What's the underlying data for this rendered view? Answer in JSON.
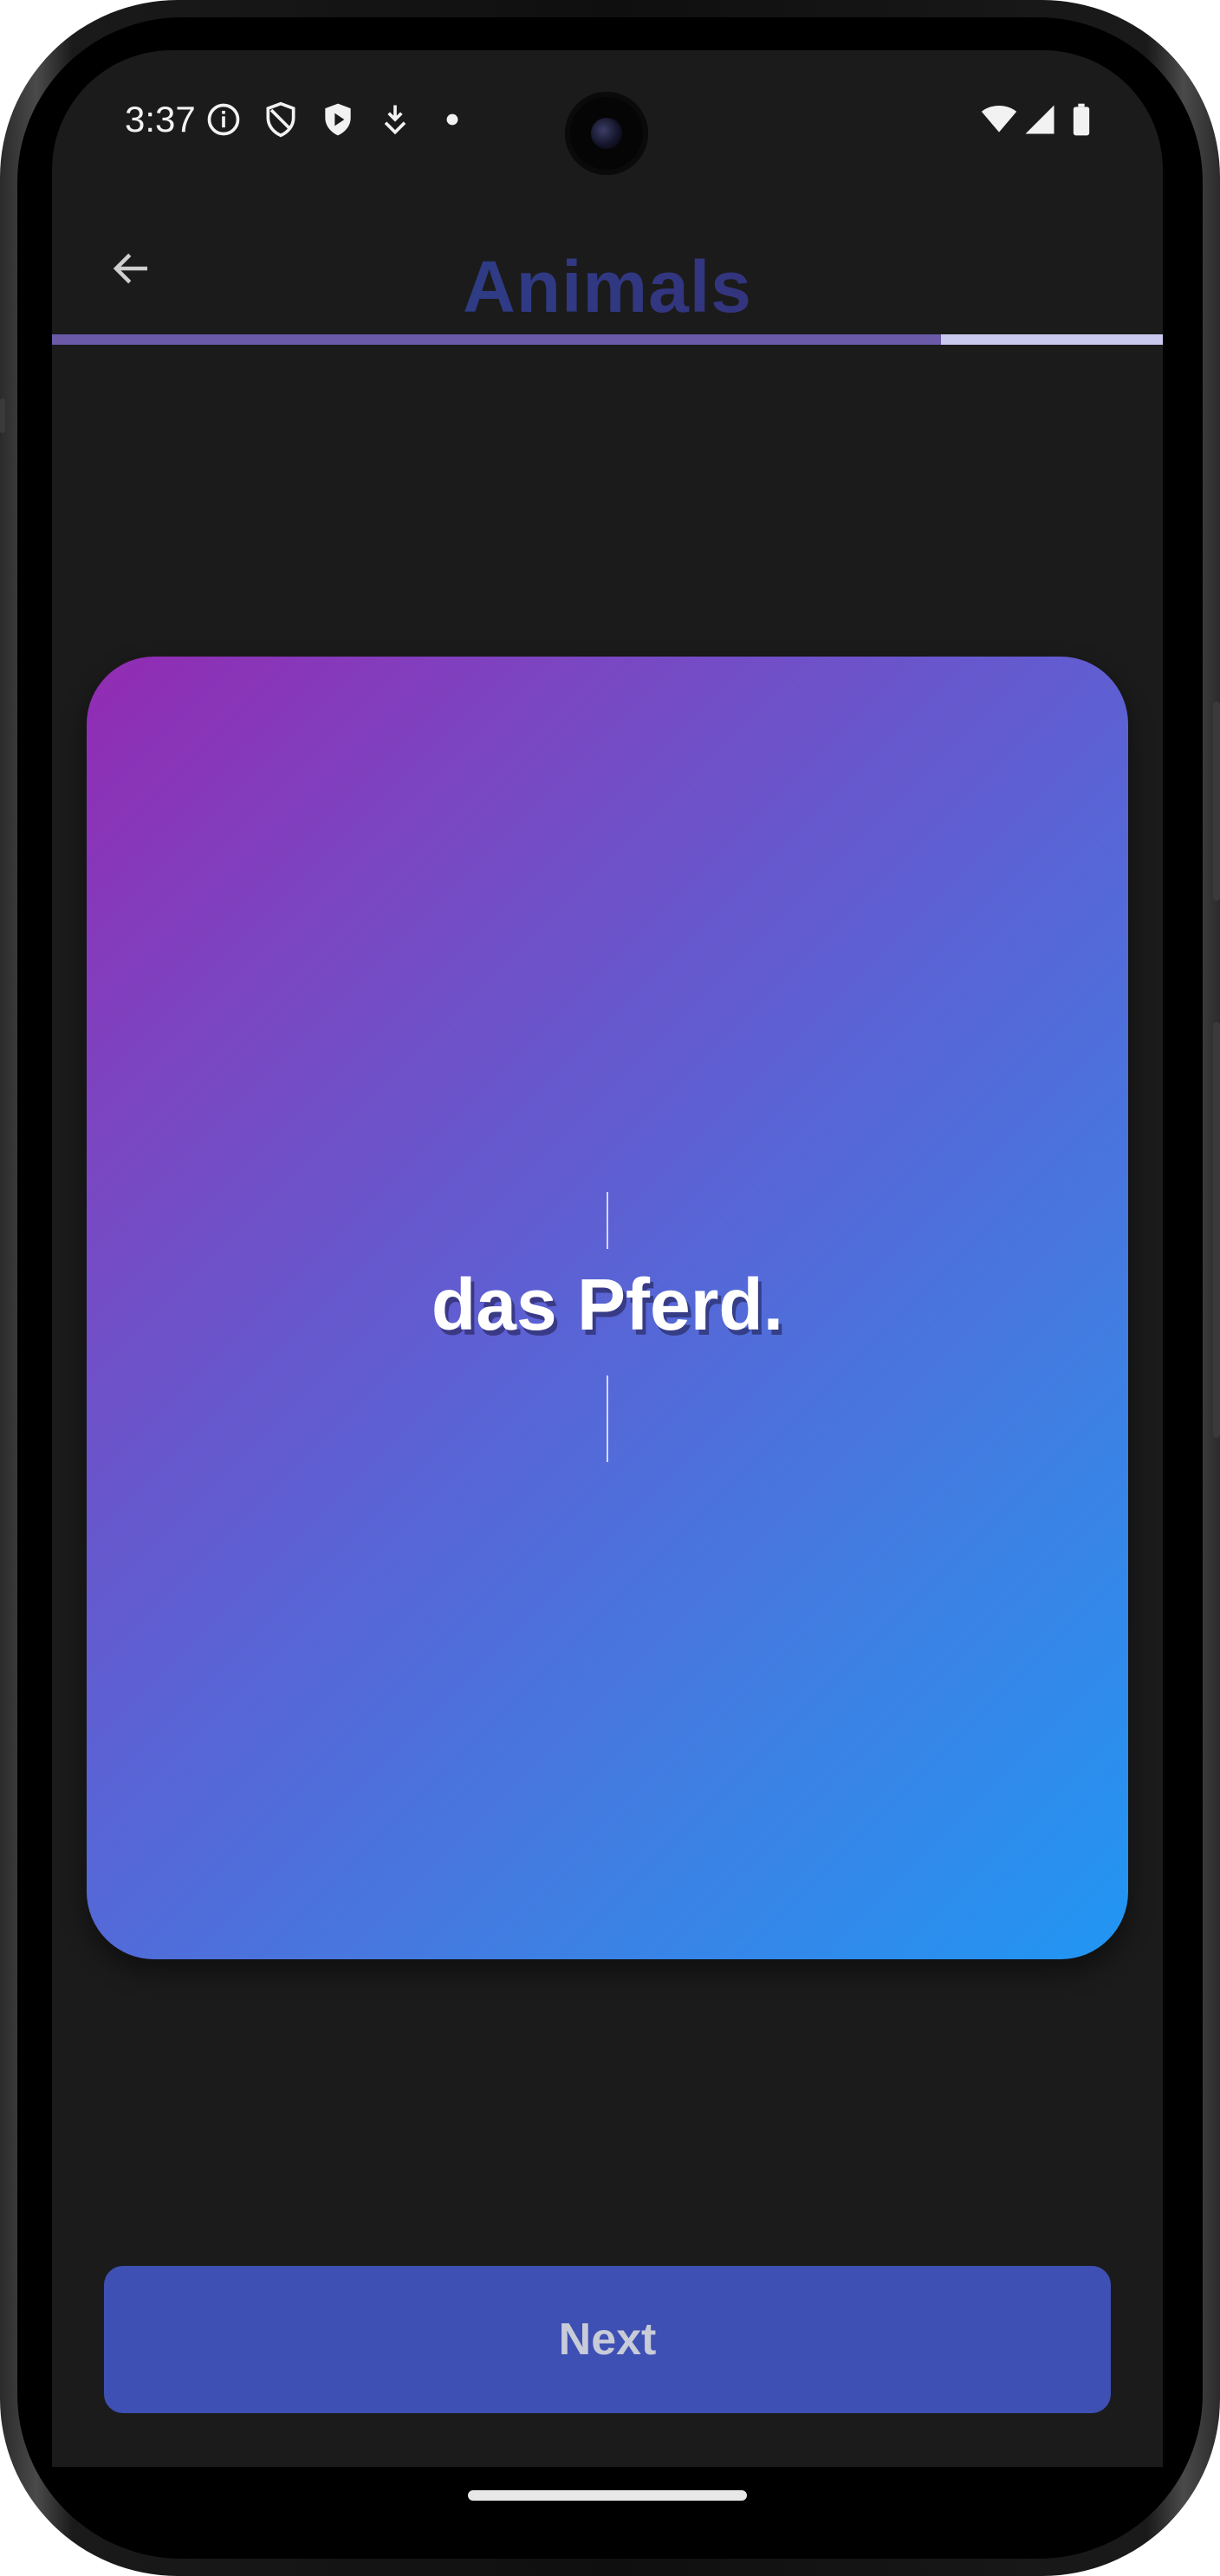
{
  "status_bar": {
    "time": "3:37",
    "left_icons": [
      "info-icon",
      "shield-outline-icon",
      "shield-play-icon",
      "download-arrow-icon",
      "dot-icon"
    ],
    "right_icons": [
      "wifi-icon",
      "signal-icon",
      "battery-icon"
    ]
  },
  "header": {
    "title": "Animals",
    "back_icon": "arrow-back-icon",
    "progress": 0.8,
    "colors": {
      "progress_fill": "#6a5aa8",
      "progress_track": "#c9c8ef"
    }
  },
  "card": {
    "word": "das Pferd.",
    "gradient_start": "#922bb3",
    "gradient_end": "#2196f3"
  },
  "footer": {
    "next_label": "Next",
    "accent": "#3e50b3"
  }
}
